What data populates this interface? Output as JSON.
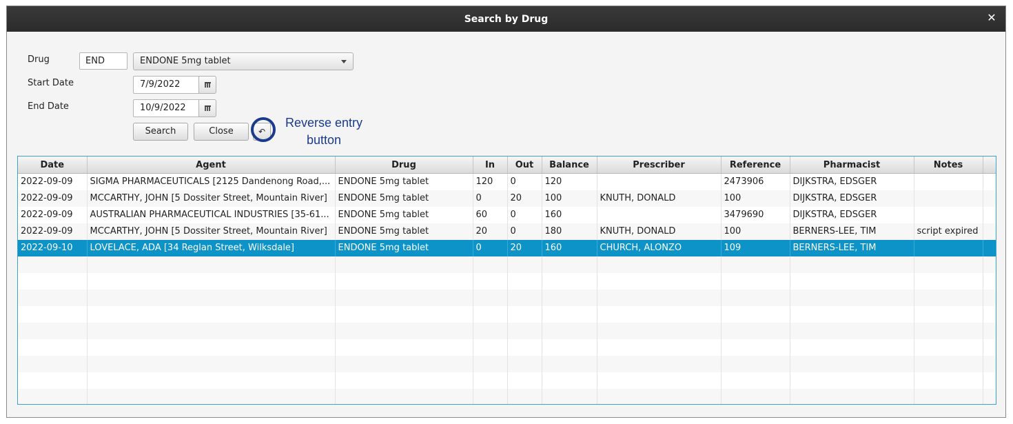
{
  "window": {
    "title": "Search by Drug",
    "close_glyph": "✕"
  },
  "form": {
    "drug_label": "Drug",
    "drug_code": "END",
    "drug_selected": "ENDONE 5mg tablet",
    "start_date_label": "Start Date",
    "start_date": "7/9/2022",
    "end_date_label": "End Date",
    "end_date": "10/9/2022",
    "search_button": "Search",
    "close_button": "Close",
    "reverse_button_glyph": "↶"
  },
  "annotation": {
    "line1": "Reverse entry",
    "line2": "button",
    "color": "#1a3a8c"
  },
  "table": {
    "columns": [
      "Date",
      "Agent",
      "Drug",
      "In",
      "Out",
      "Balance",
      "Prescriber",
      "Reference",
      "Pharmacist",
      "Notes"
    ],
    "rows": [
      [
        "2022-09-09",
        "SIGMA PHARMACEUTICALS [2125 Dandenong Road,...",
        "ENDONE 5mg tablet",
        "120",
        "0",
        "120",
        "",
        "2473906",
        "DIJKSTRA, EDSGER",
        ""
      ],
      [
        "2022-09-09",
        "MCCARTHY, JOHN [5 Dossiter Street, Mountain River]",
        "ENDONE 5mg tablet",
        "0",
        "20",
        "100",
        "KNUTH, DONALD",
        "100",
        "DIJKSTRA, EDSGER",
        ""
      ],
      [
        "2022-09-09",
        "AUSTRALIAN PHARMACEUTICAL INDUSTRIES [35-61...",
        "ENDONE 5mg tablet",
        "60",
        "0",
        "160",
        "",
        "3479690",
        "DIJKSTRA, EDSGER",
        ""
      ],
      [
        "2022-09-09",
        "MCCARTHY, JOHN [5 Dossiter Street, Mountain River]",
        "ENDONE 5mg tablet",
        "20",
        "0",
        "180",
        "KNUTH, DONALD",
        "100",
        "BERNERS-LEE, TIM",
        "script expired"
      ],
      [
        "2022-09-10",
        "LOVELACE, ADA [34 Reglan Street, Wilksdale]",
        "ENDONE 5mg tablet",
        "0",
        "20",
        "160",
        "CHURCH, ALONZO",
        "109",
        "BERNERS-LEE, TIM",
        ""
      ]
    ],
    "selected_row_index": 4,
    "selection_color": "#0d93c7"
  }
}
